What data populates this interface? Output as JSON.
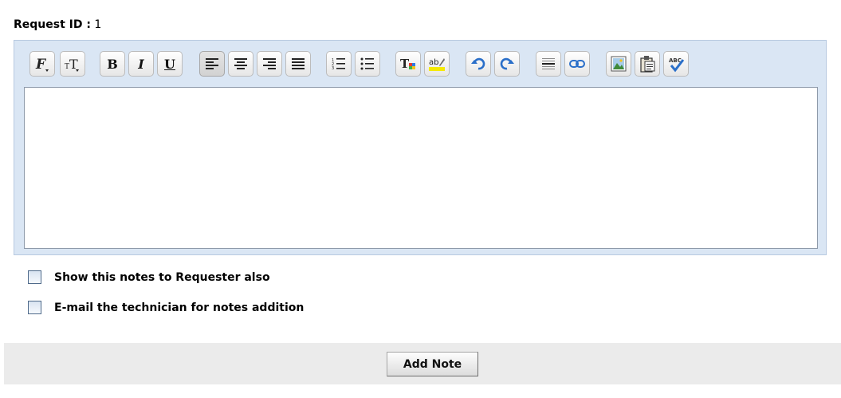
{
  "request": {
    "id_label": "Request ID :",
    "id_value": "1"
  },
  "toolbar": {
    "buttons": [
      {
        "name": "font-family-button",
        "icon": "font-family-icon"
      },
      {
        "name": "font-size-button",
        "icon": "font-size-icon"
      },
      {
        "name": "bold-button",
        "icon": "bold-icon",
        "glyph": "B"
      },
      {
        "name": "italic-button",
        "icon": "italic-icon",
        "glyph": "I"
      },
      {
        "name": "underline-button",
        "icon": "underline-icon",
        "glyph": "U"
      },
      {
        "name": "align-left-button",
        "icon": "align-left-icon",
        "active": true
      },
      {
        "name": "align-center-button",
        "icon": "align-center-icon"
      },
      {
        "name": "align-right-button",
        "icon": "align-right-icon"
      },
      {
        "name": "align-justify-button",
        "icon": "align-justify-icon"
      },
      {
        "name": "ordered-list-button",
        "icon": "ordered-list-icon"
      },
      {
        "name": "unordered-list-button",
        "icon": "unordered-list-icon"
      },
      {
        "name": "text-color-button",
        "icon": "text-color-icon"
      },
      {
        "name": "highlight-color-button",
        "icon": "highlight-icon"
      },
      {
        "name": "undo-button",
        "icon": "undo-icon"
      },
      {
        "name": "redo-button",
        "icon": "redo-icon"
      },
      {
        "name": "horizontal-rule-button",
        "icon": "horizontal-rule-icon"
      },
      {
        "name": "insert-link-button",
        "icon": "link-icon"
      },
      {
        "name": "insert-image-button",
        "icon": "image-icon"
      },
      {
        "name": "paste-button",
        "icon": "paste-icon"
      },
      {
        "name": "spell-check-button",
        "icon": "spell-check-icon"
      }
    ]
  },
  "editor": {
    "value": ""
  },
  "options": {
    "show_to_requester": {
      "label": "Show this notes to Requester also",
      "checked": false
    },
    "email_technician": {
      "label": "E-mail the technician for notes addition",
      "checked": false
    }
  },
  "footer": {
    "add_note_label": "Add Note"
  },
  "colors": {
    "editor_frame": "#dae6f4",
    "footer_bar": "#ebebeb",
    "icon_blue": "#2a6fc9"
  }
}
